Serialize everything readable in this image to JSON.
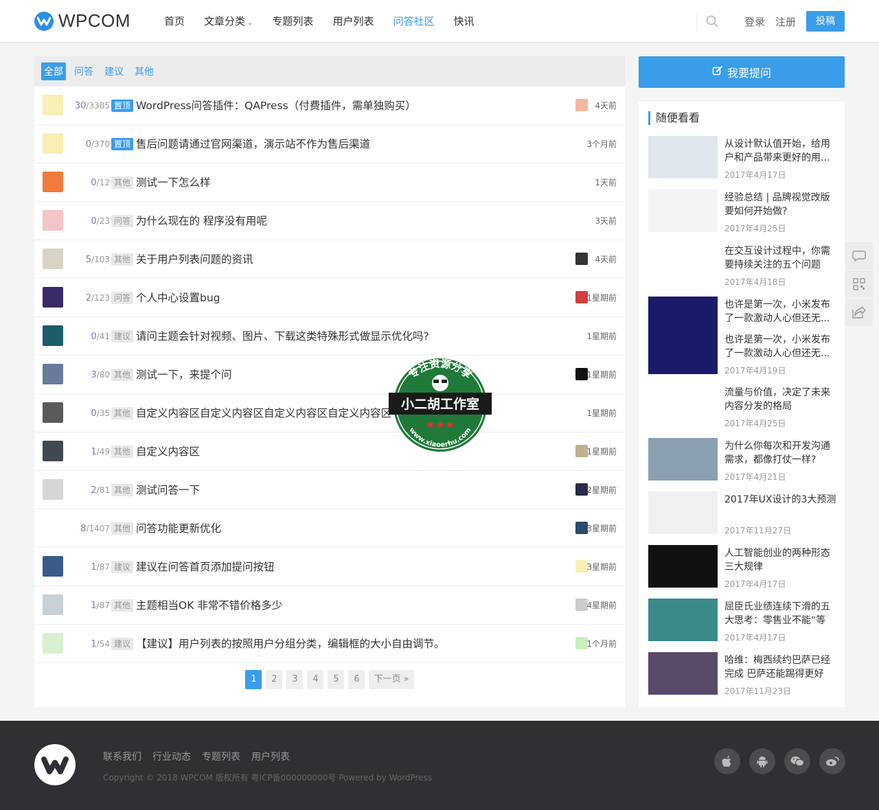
{
  "header": {
    "logo_text": "WPCOM",
    "nav": [
      {
        "label": "首页",
        "active": false
      },
      {
        "label": "文章分类",
        "active": false,
        "dropdown": true
      },
      {
        "label": "专题列表",
        "active": false
      },
      {
        "label": "用户列表",
        "active": false
      },
      {
        "label": "问答社区",
        "active": true
      },
      {
        "label": "快讯",
        "active": false
      }
    ],
    "login": "登录",
    "register": "注册",
    "submit": "投稿"
  },
  "filters": [
    {
      "label": "全部",
      "active": true
    },
    {
      "label": "问答",
      "active": false
    },
    {
      "label": "建议",
      "active": false
    },
    {
      "label": "其他",
      "active": false
    }
  ],
  "questions": [
    {
      "answers": "30",
      "views": "3385",
      "tag": "置顶",
      "tag_type": "top",
      "title": "WordPress问答插件：QAPress（付费插件，需单独购买）",
      "time": "4天前",
      "avatar_color": "#f7efb4",
      "last_avatar": "#f2b8a0"
    },
    {
      "answers": "0",
      "views": "370",
      "tag": "置顶",
      "tag_type": "top",
      "title": "售后问题请通过官网渠道，演示站不作为售后渠道",
      "time": "3个月前",
      "avatar_color": "#f7efb4",
      "last_avatar": ""
    },
    {
      "answers": "0",
      "views": "12",
      "tag": "其他",
      "tag_type": "normal",
      "title": "测试一下怎么样",
      "time": "1天前",
      "avatar_color": "#f07a3c",
      "last_avatar": ""
    },
    {
      "answers": "0",
      "views": "23",
      "tag": "问答",
      "tag_type": "normal",
      "title": "为什么现在的 程序没有用呢",
      "time": "3天前",
      "avatar_color": "#f4c4c8",
      "last_avatar": ""
    },
    {
      "answers": "5",
      "views": "103",
      "tag": "其他",
      "tag_type": "normal",
      "title": "关于用户列表问题的资讯",
      "time": "4天前",
      "avatar_color": "#d9d3c6",
      "last_avatar": "#333333"
    },
    {
      "answers": "2",
      "views": "123",
      "tag": "问答",
      "tag_type": "normal",
      "title": "个人中心设置bug",
      "time": "1星期前",
      "avatar_color": "#3a2a6a",
      "last_avatar": "#d04040"
    },
    {
      "answers": "0",
      "views": "41",
      "tag": "建议",
      "tag_type": "normal",
      "title": "请问主题会针对视频、图片、下载这类特殊形式做显示优化吗?",
      "time": "1星期前",
      "avatar_color": "#1d5c6a",
      "last_avatar": ""
    },
    {
      "answers": "3",
      "views": "80",
      "tag": "其他",
      "tag_type": "normal",
      "title": "测试一下，来提个问",
      "time": "1星期前",
      "avatar_color": "#6a7a9a",
      "last_avatar": "#111111"
    },
    {
      "answers": "0",
      "views": "35",
      "tag": "其他",
      "tag_type": "normal",
      "title": "自定义内容区自定义内容区自定义内容区自定义内容区",
      "time": "1星期前",
      "avatar_color": "#5a5a5a",
      "last_avatar": ""
    },
    {
      "answers": "1",
      "views": "49",
      "tag": "其他",
      "tag_type": "normal",
      "title": "自定义内容区",
      "time": "1星期前",
      "avatar_color": "#404850",
      "last_avatar": "#c0b090"
    },
    {
      "answers": "2",
      "views": "81",
      "tag": "其他",
      "tag_type": "normal",
      "title": "测试问答一下",
      "time": "2星期前",
      "avatar_color": "#d6d6d6",
      "last_avatar": "#2a2a4a"
    },
    {
      "answers": "8",
      "views": "1407",
      "tag": "其他",
      "tag_type": "normal",
      "title": "问答功能更新优化",
      "time": "3星期前",
      "avatar_color": "#ffffff",
      "last_avatar": "#2a4a6a"
    },
    {
      "answers": "1",
      "views": "87",
      "tag": "建议",
      "tag_type": "normal",
      "title": "建议在问答首页添加提问按钮",
      "time": "3星期前",
      "avatar_color": "#3a5a8a",
      "last_avatar": "#f7efb4"
    },
    {
      "answers": "1",
      "views": "87",
      "tag": "其他",
      "tag_type": "normal",
      "title": "主题相当OK 非常不错价格多少",
      "time": "4星期前",
      "avatar_color": "#c8d0d8",
      "last_avatar": "#cccccc"
    },
    {
      "answers": "1",
      "views": "54",
      "tag": "建议",
      "tag_type": "normal",
      "title": "【建议】用户列表的按照用户分组分类，编辑框的大小自由调节。",
      "time": "1个月前",
      "avatar_color": "#d8f0d0",
      "last_avatar": "#c8f0c0"
    }
  ],
  "pager": {
    "pages": [
      "1",
      "2",
      "3",
      "4",
      "5",
      "6"
    ],
    "current": "1",
    "next": "下一页 »"
  },
  "sidebar": {
    "ask_button": "我要提问",
    "widget_title": "随便看看",
    "posts": [
      {
        "title": "从设计默认值开始，给用户和产品带来更好的用...",
        "date": "2017年4月17日",
        "thumb": "#dfe6ee"
      },
      {
        "title": "经验总结 | 品牌视觉改版要如何开始做?",
        "date": "2017年4月25日",
        "thumb": "#f4f4f4"
      },
      {
        "title": "在交互设计过程中，你需要持续关注的五个问题",
        "date": "2017年4月18日",
        "thumb": "#ffffff"
      },
      {
        "title": "也许是第一次，小米发布了一款激动人心但还无...",
        "date": "",
        "thumb": "#1a1a6a"
      },
      {
        "title": "也许是第一次，小米发布了一款激动人心但还无...",
        "date": "2017年4月19日",
        "thumb": "#1a1a6a"
      },
      {
        "title": "流量与价值，决定了未来内容分发的格局",
        "date": "2017年4月25日",
        "thumb": "#ffffff"
      },
      {
        "title": "为什么你每次和开发沟通需求，都像打仗一样?",
        "date": "2017年4月21日",
        "thumb": "#8aa0b0"
      },
      {
        "title": "2017年UX设计的3大预测",
        "date": "2017年11月27日",
        "thumb": "#f0f0f0"
      },
      {
        "title": "人工智能创业的两种形态三大规律",
        "date": "2017年4月17日",
        "thumb": "#111111"
      },
      {
        "title": "屈臣氏业绩连续下滑的五大思考：零售业不能“等",
        "date": "2017年4月17日",
        "thumb": "#3a8a8a"
      },
      {
        "title": "哈维：梅西续约巴萨已经完成 巴萨还能踢得更好",
        "date": "2017年11月23日",
        "thumb": "#5a4a6a"
      }
    ]
  },
  "watermark": {
    "top": "专注资源分享",
    "middle": "小二胡工作室",
    "bottom": "www.xiaoerhu.com"
  },
  "footer": {
    "links": [
      "联系我们",
      "行业动态",
      "专题列表",
      "用户列表"
    ],
    "copyright": "Copyright © 2018 WPCOM 版权所有 粤ICP备000000000号 Powered by WordPress"
  },
  "colors": {
    "accent": "#3a9de9",
    "footer_bg": "#2e3033",
    "answer_count": "#8a70c4"
  }
}
